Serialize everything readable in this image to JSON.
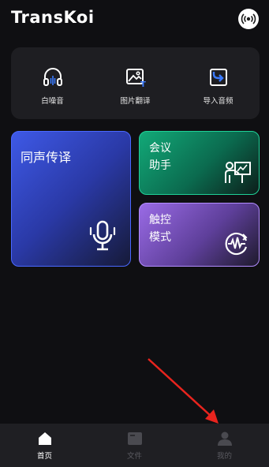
{
  "header": {
    "logo_text": "TransKoi",
    "broadcast_icon": "broadcast-icon"
  },
  "tools": [
    {
      "label": "白噪音",
      "icon": "headphones-icon"
    },
    {
      "label": "图片翻译",
      "icon": "image-translate-icon"
    },
    {
      "label": "导入音频",
      "icon": "import-audio-icon"
    }
  ],
  "cards": {
    "simultaneous": {
      "title": "同声传译",
      "icon": "microphone-icon"
    },
    "meeting": {
      "title_line1": "会议",
      "title_line2": "助手",
      "icon": "presentation-icon"
    },
    "touch": {
      "title_line1": "触控",
      "title_line2": "模式",
      "icon": "touch-waveform-icon"
    }
  },
  "tabbar": [
    {
      "label": "首页",
      "icon": "home-icon",
      "active": true
    },
    {
      "label": "文件",
      "icon": "folder-icon",
      "active": false
    },
    {
      "label": "我的",
      "icon": "profile-icon",
      "active": false
    }
  ],
  "colors": {
    "background": "#0f0f12",
    "accent_blue": "#4a68ff",
    "accent_green": "#1fd197",
    "accent_purple": "#b28cff",
    "arrow_red": "#e8241e"
  }
}
